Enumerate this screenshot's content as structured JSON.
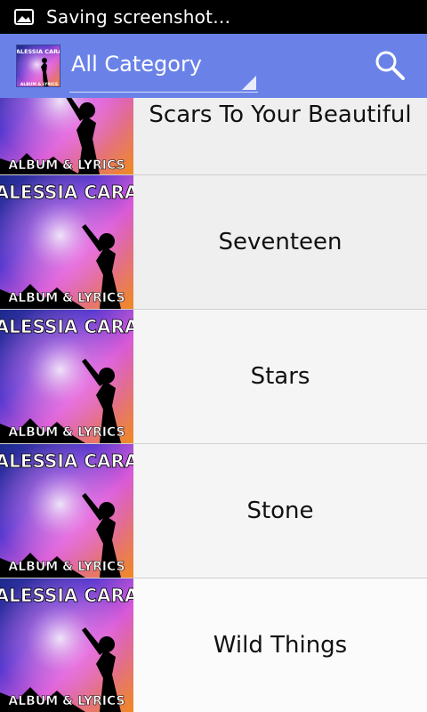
{
  "status_bar": {
    "text": "Saving screenshot…",
    "icon": "image-icon"
  },
  "action_bar": {
    "logo": {
      "line1": "ALESSIA CARA",
      "line2": "ALBUM & LYRICS"
    },
    "category_spinner": {
      "selected": "All Category"
    },
    "search_icon": "search-icon",
    "color": "#6a82e8"
  },
  "songs": [
    {
      "title": "Scars To Your Beautiful",
      "art_top": "",
      "art_bottom": "ALBUM & LYRICS"
    },
    {
      "title": "Seventeen",
      "art_top": "ALESSIA CARA",
      "art_bottom": "ALBUM & LYRICS"
    },
    {
      "title": "Stars",
      "art_top": "ALESSIA CARA",
      "art_bottom": "ALBUM & LYRICS"
    },
    {
      "title": "Stone",
      "art_top": "ALESSIA CARA",
      "art_bottom": "ALBUM & LYRICS"
    },
    {
      "title": "Wild Things",
      "art_top": "ALESSIA CARA",
      "art_bottom": "ALBUM & LYRICS"
    }
  ]
}
